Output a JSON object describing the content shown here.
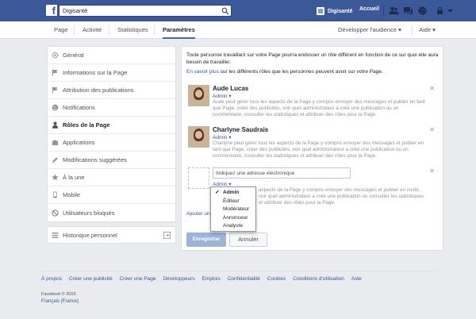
{
  "topbar": {
    "search_value": "Digisanté",
    "page_name": "Digisanté",
    "home_label": "Accueil"
  },
  "pagenav": {
    "tabs": [
      "Page",
      "Activité",
      "Statistiques",
      "Paramètres"
    ],
    "active_tab": "Paramètres",
    "audience_label": "Développer l'audience",
    "help_label": "Aide"
  },
  "sidebar": {
    "items": [
      {
        "label": "Général",
        "icon": "gear-icon"
      },
      {
        "label": "Informations sur la Page",
        "icon": "flag-icon"
      },
      {
        "label": "Attribution des publications",
        "icon": "flag-icon"
      },
      {
        "label": "Notifications",
        "icon": "globe-icon"
      },
      {
        "label": "Rôles de la Page",
        "icon": "person-icon"
      },
      {
        "label": "Applications",
        "icon": "puzzle-icon"
      },
      {
        "label": "Modifications suggérées",
        "icon": "pencil-icon"
      },
      {
        "label": "À la une",
        "icon": "star-icon"
      },
      {
        "label": "Mobile",
        "icon": "phone-icon"
      },
      {
        "label": "Utilisateurs bloqués",
        "icon": "block-icon"
      }
    ],
    "active_item": "Rôles de la Page",
    "history_label": "Historique personnel"
  },
  "main": {
    "intro": "Toute personne travaillant sur votre Page pourra endosser un rôle différent en fonction de ce sur quoi elle aura besoin de travailler.",
    "learn_link": "En savoir plus",
    "learn_rest": " sur les différents rôles que les personnes peuvent avoir sur votre Page.",
    "people": [
      {
        "name": "Aude Lucas",
        "role": "Admin",
        "description": "Aude peut gérer tous les aspects de la Page y compris envoyer des messages et publier en tant que Page, créer des publicités, voir quel administrateur a créé une publication ou un commentaire, consulter les statistiques et attribuer des rôles pour la Page."
      },
      {
        "name": "Charlyne Saudrais",
        "role": "Admin",
        "description": "Charlyne peut gérer tous les aspects de la Page y compris envoyer des messages et publier en tant que Page, créer des publicités, voir quel administrateur a créé une publication ou un commentaire, consulter les statistiques et attribuer des rôles pour la Page."
      }
    ],
    "new_role": {
      "email_placeholder": "Indiquez une adresse électronique",
      "selected_role": "Admin",
      "description": "aspects de la Page y compris envoyer des messages et publier en nicité, voir quel administrateur a créé une publication ou consulter les statistiques et attribuer des rôles pour la Page.",
      "options": [
        "Admin",
        "Éditeur",
        "Modérateur",
        "Annonceur",
        "Analyste"
      ]
    },
    "add_link": "Ajouter une",
    "save_label": "Enregistrer",
    "cancel_label": "Annuler"
  },
  "footer": {
    "links": [
      "À propos",
      "Créer une publicité",
      "Créer une Page",
      "Développeurs",
      "Emplois",
      "Confidentialité",
      "Cookies",
      "Conditions d'utilisation",
      "Aide"
    ],
    "copyright": "Facebook © 2015",
    "language": "Français (France)"
  },
  "colors": {
    "brand": "#3b5998",
    "link": "#365899",
    "save_button": "#9cb4d8"
  }
}
